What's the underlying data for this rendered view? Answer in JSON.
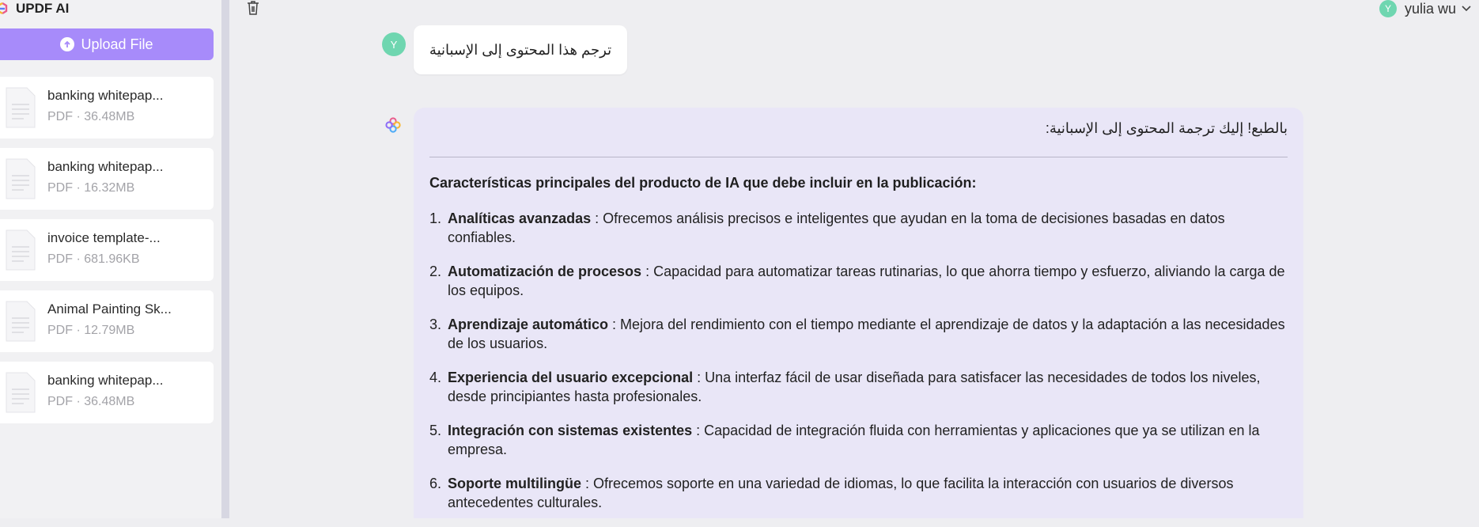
{
  "app": {
    "title": "UPDF AI"
  },
  "sidebar": {
    "upload_label": "Upload File",
    "files": [
      {
        "name": "banking whitepap...",
        "meta": "PDF · 36.48MB"
      },
      {
        "name": "banking whitepap...",
        "meta": "PDF · 16.32MB"
      },
      {
        "name": "invoice template-...",
        "meta": "PDF · 681.96KB"
      },
      {
        "name": "Animal Painting Sk...",
        "meta": "PDF · 12.79MB"
      },
      {
        "name": "banking whitepap...",
        "meta": "PDF · 36.48MB"
      }
    ]
  },
  "header": {
    "user_name": "yulia wu",
    "avatar_letter": "Y"
  },
  "chat": {
    "user_message": "ترجم هذا المحتوى إلى الإسبانية",
    "user_avatar_letter": "Y",
    "ai_intro": "بالطبع! إليك ترجمة المحتوى إلى الإسبانية:",
    "ai_heading": "Características principales del producto de IA que debe incluir en la publicación:",
    "features": [
      {
        "num": "1.",
        "title": "Analíticas avanzadas",
        "text": " : Ofrecemos análisis precisos e inteligentes que ayudan en la toma de decisiones basadas en datos confiables."
      },
      {
        "num": "2.",
        "title": "Automatización de procesos",
        "text": " : Capacidad para automatizar tareas rutinarias, lo que ahorra tiempo y esfuerzo, aliviando la carga de los equipos."
      },
      {
        "num": "3.",
        "title": "Aprendizaje automático",
        "text": " : Mejora del rendimiento con el tiempo mediante el aprendizaje de datos y la adaptación a las necesidades de los usuarios."
      },
      {
        "num": "4.",
        "title": "Experiencia del usuario excepcional",
        "text": " : Una interfaz fácil de usar diseñada para satisfacer las necesidades de todos los niveles, desde principiantes hasta profesionales."
      },
      {
        "num": "5.",
        "title": "Integración con sistemas existentes",
        "text": " : Capacidad de integración fluida con herramientas y aplicaciones que ya se utilizan en la empresa."
      },
      {
        "num": "6.",
        "title": "Soporte multilingüe",
        "text": " : Ofrecemos soporte en una variedad de idiomas, lo que facilita la interacción con usuarios de diversos antecedentes culturales."
      }
    ]
  },
  "icons": {
    "brand": "updf-logo-icon",
    "upload": "upload-arrow-icon",
    "file": "document-icon",
    "trash": "trash-icon",
    "chevron": "chevron-down-icon",
    "ai": "ai-logo-icon"
  },
  "colors": {
    "accent": "#a78bfa",
    "avatar": "#6fd6b0",
    "ai_bubble": "#e9e6f7"
  }
}
